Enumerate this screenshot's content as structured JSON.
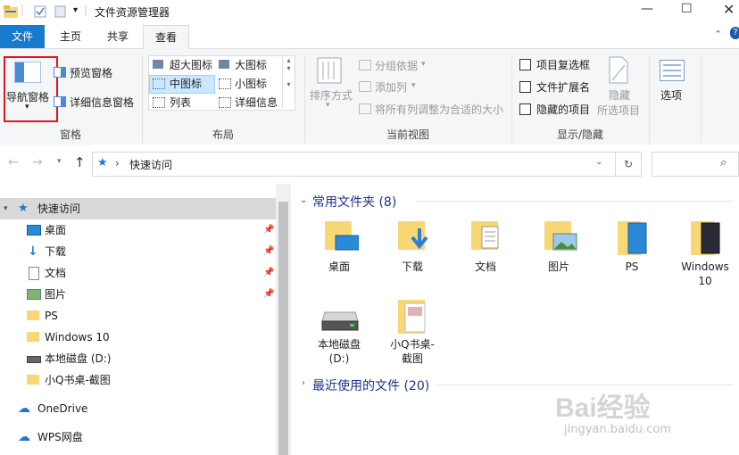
{
  "window": {
    "title": "文件资源管理器"
  },
  "menu_tabs": [
    "文件",
    "主页",
    "共享",
    "查看"
  ],
  "ribbon": {
    "pane_group": {
      "nav_pane": "导航窗格",
      "preview_pane": "预览窗格",
      "details_pane": "详细信息窗格",
      "label": "窗格"
    },
    "layout_group": {
      "items": [
        "超大图标",
        "大图标",
        "中图标",
        "小图标",
        "列表",
        "详细信息"
      ],
      "selected": "中图标",
      "label": "布局"
    },
    "view_group": {
      "sort": "排序方式",
      "group_by": "分组依据",
      "add_column": "添加列",
      "fit_columns": "将所有列调整为合适的大小",
      "label": "当前视图"
    },
    "showhide_group": {
      "checkboxes": [
        "项目复选框",
        "文件扩展名",
        "隐藏的项目"
      ],
      "hide_selected_line1": "隐藏",
      "hide_selected_line2": "所选项目",
      "label": "显示/隐藏"
    },
    "options": "选项"
  },
  "address": {
    "separator": "›",
    "path": "快速访问"
  },
  "nav_pane": {
    "quick_access": "快速访问",
    "items": [
      "桌面",
      "下载",
      "文档",
      "图片",
      "PS",
      "Windows 10",
      "本地磁盘 (D:)",
      "小Q书桌-截图"
    ],
    "onedrive": "OneDrive",
    "wps": "WPS网盘"
  },
  "content": {
    "frequent_header": "常用文件夹 (8)",
    "frequent": [
      "桌面",
      "下载",
      "文档",
      "图片",
      "PS",
      "Windows\n10",
      "本地磁盘\n(D:)",
      "小Q书桌-\n截图"
    ],
    "recent_header": "最近使用的文件 (20)"
  },
  "watermark": {
    "brand": "Bai经验",
    "url": "jingyan.baidu.com"
  },
  "colors": {
    "file_tab": "#1979ca",
    "selected_highlight": "#cce8ff",
    "folder": "#f8d775",
    "accent_blue": "#1c5bac",
    "red_box": "#e81123"
  }
}
